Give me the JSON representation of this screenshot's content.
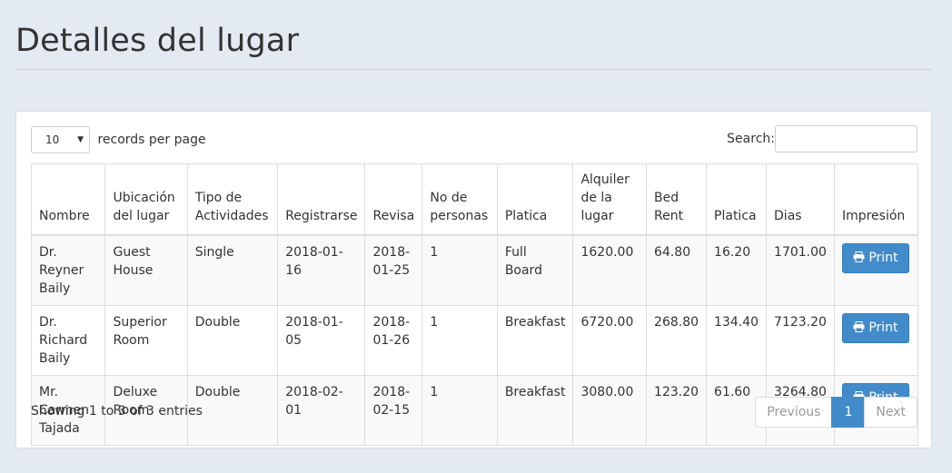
{
  "page": {
    "title": "Detalles del lugar"
  },
  "length": {
    "value": "10",
    "label": "records per page"
  },
  "search": {
    "label": "Search:",
    "value": ""
  },
  "table": {
    "headers": [
      "Nombre",
      "Ubicación del lugar",
      "Tipo de Actividades",
      "Registrarse",
      "Revisa",
      "No de personas",
      "Platica",
      "Alquiler de la lugar",
      "Bed Rent",
      "Platica",
      "Dias",
      "Impresión"
    ],
    "rows": [
      [
        "Dr. Reyner Baily",
        "Guest House",
        "Single",
        "2018-01-16",
        "2018-01-25",
        "1",
        "Full Board",
        "1620.00",
        "64.80",
        "16.20",
        "1701.00"
      ],
      [
        "Dr. Richard Baily",
        "Superior Room",
        "Double",
        "2018-01-05",
        "2018-01-26",
        "1",
        "Breakfast",
        "6720.00",
        "268.80",
        "134.40",
        "7123.20"
      ],
      [
        "Mr. Carmen Tajada",
        "Deluxe Room",
        "Double",
        "2018-02-01",
        "2018-02-15",
        "1",
        "Breakfast",
        "3080.00",
        "123.20",
        "61.60",
        "3264.80"
      ]
    ],
    "print_label": "Print"
  },
  "info": "Showing 1 to 3 of 3 entries",
  "pagination": {
    "previous": "Previous",
    "current": "1",
    "next": "Next"
  },
  "colors": {
    "accent": "#428bca",
    "background": "#e4eaf2"
  }
}
